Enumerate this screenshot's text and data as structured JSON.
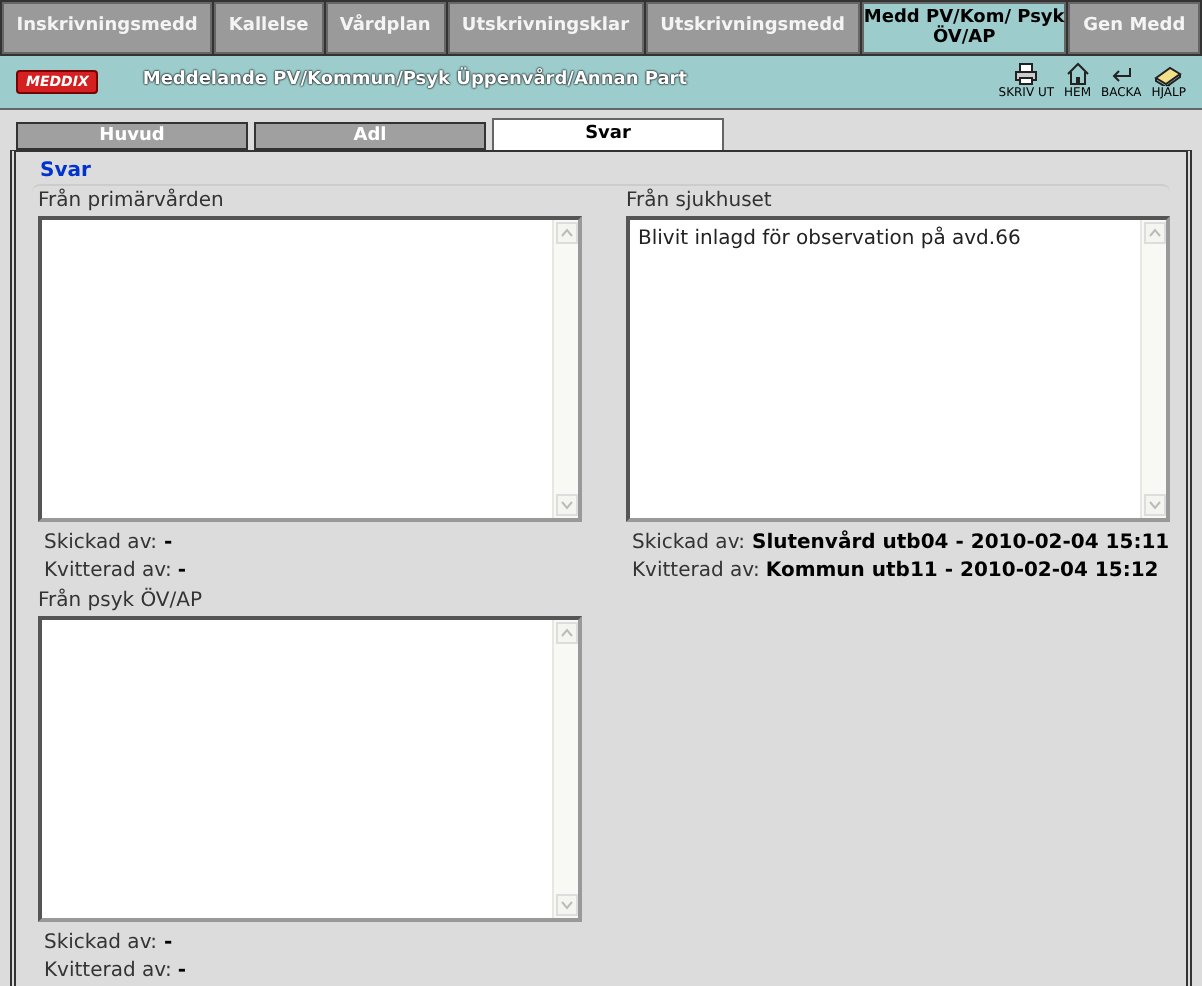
{
  "nav_tabs": [
    {
      "label": "Inskrivningsmedd",
      "selected": false
    },
    {
      "label": "Kallelse",
      "selected": false
    },
    {
      "label": "Vårdplan",
      "selected": false
    },
    {
      "label": "Utskrivningsklar",
      "selected": false
    },
    {
      "label": "Utskrivningsmedd",
      "selected": false
    },
    {
      "label": "Medd PV/Kom/ Psyk ÖV/AP",
      "selected": true
    },
    {
      "label": "Gen Medd",
      "selected": false
    }
  ],
  "header": {
    "logo": "MEDDIX",
    "title": "Meddelande PV/Kommun/Psyk Üppenvård/Annan Part",
    "tools": [
      {
        "kind": "print",
        "label": "SKRIV UT"
      },
      {
        "kind": "home",
        "label": "HEM"
      },
      {
        "kind": "back",
        "label": "BACKA"
      },
      {
        "kind": "help",
        "label": "HJÄLP"
      }
    ]
  },
  "sub_tabs": [
    {
      "label": "Huvud",
      "selected": false
    },
    {
      "label": "Adl",
      "selected": false
    },
    {
      "label": "Svar",
      "selected": true
    }
  ],
  "section_title": "Svar",
  "panels": [
    {
      "label": "Från primärvården",
      "sent_label": "Skickad av:",
      "sent_by": "-",
      "ack_label": "Kvitterad av:",
      "ack_by": "-"
    },
    {
      "label": "Från sjukhuset",
      "text": "Blivit inlagd för observation på avd.66",
      "sent_label": "Skickad av:",
      "sent_by": "Slutenvård utb04 - 2010-02-04 15:11",
      "ack_label": "Kvitterad av:",
      "ack_by": "Kommun utb11 - 2010-02-04 15:12"
    },
    {
      "label": "Från psyk ÖV/AP",
      "sent_label": "Skickad av:",
      "sent_by": "-",
      "ack_label": "Kvitterad av:",
      "ack_by": "-"
    }
  ]
}
